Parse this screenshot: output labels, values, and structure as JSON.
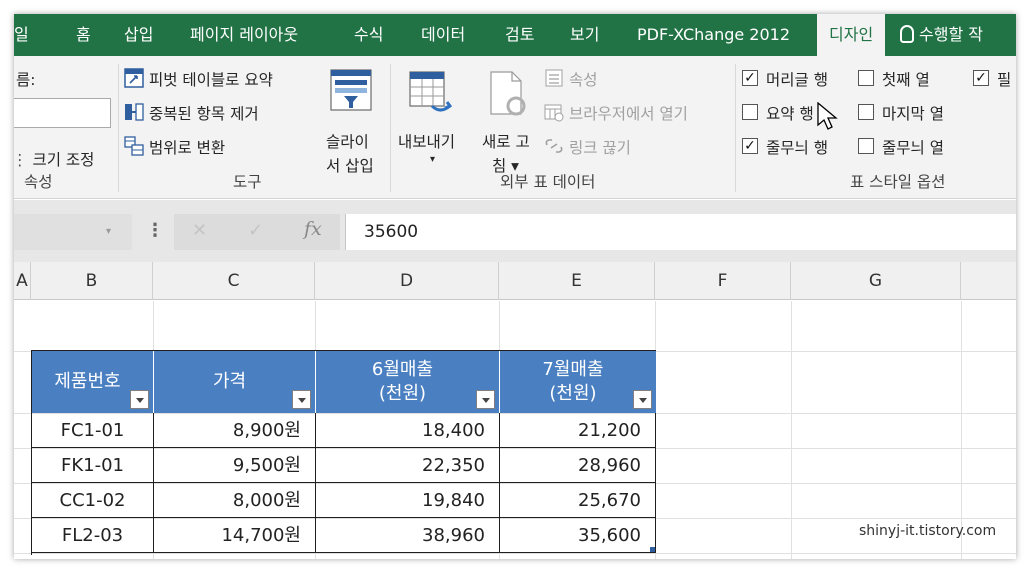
{
  "tabs": [
    "일",
    "홈",
    "삽입",
    "페이지 레이아웃",
    "수식",
    "데이터",
    "검토",
    "보기",
    "PDF-XChange 2012",
    "디자인"
  ],
  "tell_me": "수행할 작",
  "ribbon": {
    "properties": {
      "name_label": "름:",
      "resize_label": "크기 조정",
      "group_label": "속성"
    },
    "tools": {
      "summarize_pivot": "피벗 테이블로 요약",
      "remove_duplicates": "중복된 항목 제거",
      "convert_range": "범위로 변환",
      "slicer_line1": "슬라이",
      "slicer_line2": "서 삽입",
      "group_label": "도구"
    },
    "external": {
      "export_line1": "내보내기",
      "export_arrow": "▾",
      "refresh_line1": "새로 고",
      "refresh_line2": "침 ▾",
      "properties": "속성",
      "open_browser": "브라우저에서 열기",
      "unlink": "링크 끊기",
      "group_label": "외부 표 데이터"
    },
    "style_options": {
      "header_row": "머리글 행",
      "total_row": "요약 행",
      "banded_rows": "줄무늬 행",
      "first_column": "첫째 열",
      "last_column": "마지막 열",
      "banded_columns": "줄무늬 열",
      "filter_button": "필",
      "group_label": "표 스타일 옵션",
      "checked": {
        "header_row": true,
        "total_row": false,
        "banded_rows": true,
        "first_column": false,
        "last_column": false,
        "banded_columns": false,
        "filter_button": true
      }
    }
  },
  "formula_bar": {
    "fx": "fx",
    "value": "35600",
    "cancel": "✕",
    "enter": "✓"
  },
  "columns": [
    "A",
    "B",
    "C",
    "D",
    "E",
    "F",
    "G"
  ],
  "table": {
    "headers": [
      {
        "line1": "제품번호",
        "line2": ""
      },
      {
        "line1": "가격",
        "line2": ""
      },
      {
        "line1": "6월매출",
        "line2": "(천원)"
      },
      {
        "line1": "7월매출",
        "line2": "(천원)"
      }
    ],
    "rows": [
      [
        "FC1-01",
        "8,900원",
        "18,400",
        "21,200"
      ],
      [
        "FK1-01",
        "9,500원",
        "22,350",
        "28,960"
      ],
      [
        "CC1-02",
        "8,000원",
        "19,840",
        "25,670"
      ],
      [
        "FL2-03",
        "14,700원",
        "38,960",
        "35,600"
      ]
    ]
  },
  "watermark": "shinyj-it.tistory.com",
  "colors": {
    "tab_green": "#217346",
    "table_header": "#4a7fc1"
  }
}
